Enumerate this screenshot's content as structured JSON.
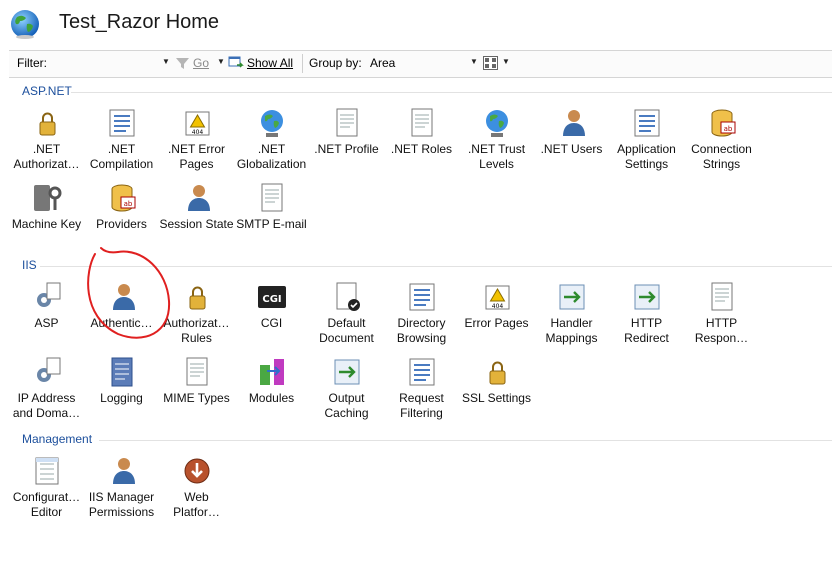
{
  "header": {
    "title": "Test_Razor Home",
    "icon": "globe-icon"
  },
  "toolbar": {
    "filter_label": "Filter:",
    "filter_value": "",
    "go_label": "Go",
    "show_all_label": "Show All",
    "group_by_label": "Group by:",
    "group_by_value": "Area"
  },
  "sections": [
    {
      "title": "ASP.NET",
      "items": [
        {
          "label": ".NET\nAuthorizat…",
          "icon": "net-authorization-icon"
        },
        {
          "label": ".NET\nCompilation",
          "icon": "net-compilation-icon"
        },
        {
          "label": ".NET Error\nPages",
          "icon": "net-error-pages-icon"
        },
        {
          "label": ".NET\nGlobalization",
          "icon": "net-globalization-icon"
        },
        {
          "label": ".NET Profile",
          "icon": "net-profile-icon"
        },
        {
          "label": ".NET Roles",
          "icon": "net-roles-icon"
        },
        {
          "label": ".NET Trust\nLevels",
          "icon": "net-trust-levels-icon"
        },
        {
          "label": ".NET Users",
          "icon": "net-users-icon"
        },
        {
          "label": "Application\nSettings",
          "icon": "application-settings-icon"
        },
        {
          "label": "Connection\nStrings",
          "icon": "connection-strings-icon"
        },
        {
          "label": "Machine Key",
          "icon": "machine-key-icon"
        },
        {
          "label": "Providers",
          "icon": "providers-icon"
        },
        {
          "label": "Session State",
          "icon": "session-state-icon"
        },
        {
          "label": "SMTP E-mail",
          "icon": "smtp-email-icon"
        }
      ]
    },
    {
      "title": "IIS",
      "items": [
        {
          "label": "ASP",
          "icon": "asp-icon"
        },
        {
          "label": "Authentic…",
          "icon": "authentication-icon"
        },
        {
          "label": "Authorizat…\nRules",
          "icon": "authorization-rules-icon"
        },
        {
          "label": "CGI",
          "icon": "cgi-icon"
        },
        {
          "label": "Default\nDocument",
          "icon": "default-document-icon"
        },
        {
          "label": "Directory\nBrowsing",
          "icon": "directory-browsing-icon"
        },
        {
          "label": "Error Pages",
          "icon": "error-pages-icon"
        },
        {
          "label": "Handler\nMappings",
          "icon": "handler-mappings-icon"
        },
        {
          "label": "HTTP\nRedirect",
          "icon": "http-redirect-icon"
        },
        {
          "label": "HTTP\nRespon…",
          "icon": "http-response-headers-icon"
        },
        {
          "label": "IP Address\nand Doma…",
          "icon": "ip-address-domain-icon"
        },
        {
          "label": "Logging",
          "icon": "logging-icon"
        },
        {
          "label": "MIME Types",
          "icon": "mime-types-icon"
        },
        {
          "label": "Modules",
          "icon": "modules-icon"
        },
        {
          "label": "Output\nCaching",
          "icon": "output-caching-icon"
        },
        {
          "label": "Request\nFiltering",
          "icon": "request-filtering-icon"
        },
        {
          "label": "SSL Settings",
          "icon": "ssl-settings-icon"
        }
      ]
    },
    {
      "title": "Management",
      "items": [
        {
          "label": "Configurat…\nEditor",
          "icon": "configuration-editor-icon"
        },
        {
          "label": "IIS Manager\nPermissions",
          "icon": "iis-manager-permissions-icon"
        },
        {
          "label": "Web\nPlatfor…",
          "icon": "web-platform-installer-icon"
        }
      ]
    }
  ],
  "annotation": {
    "type": "red-circle",
    "target": "Authentic…",
    "color": "#e02020"
  }
}
